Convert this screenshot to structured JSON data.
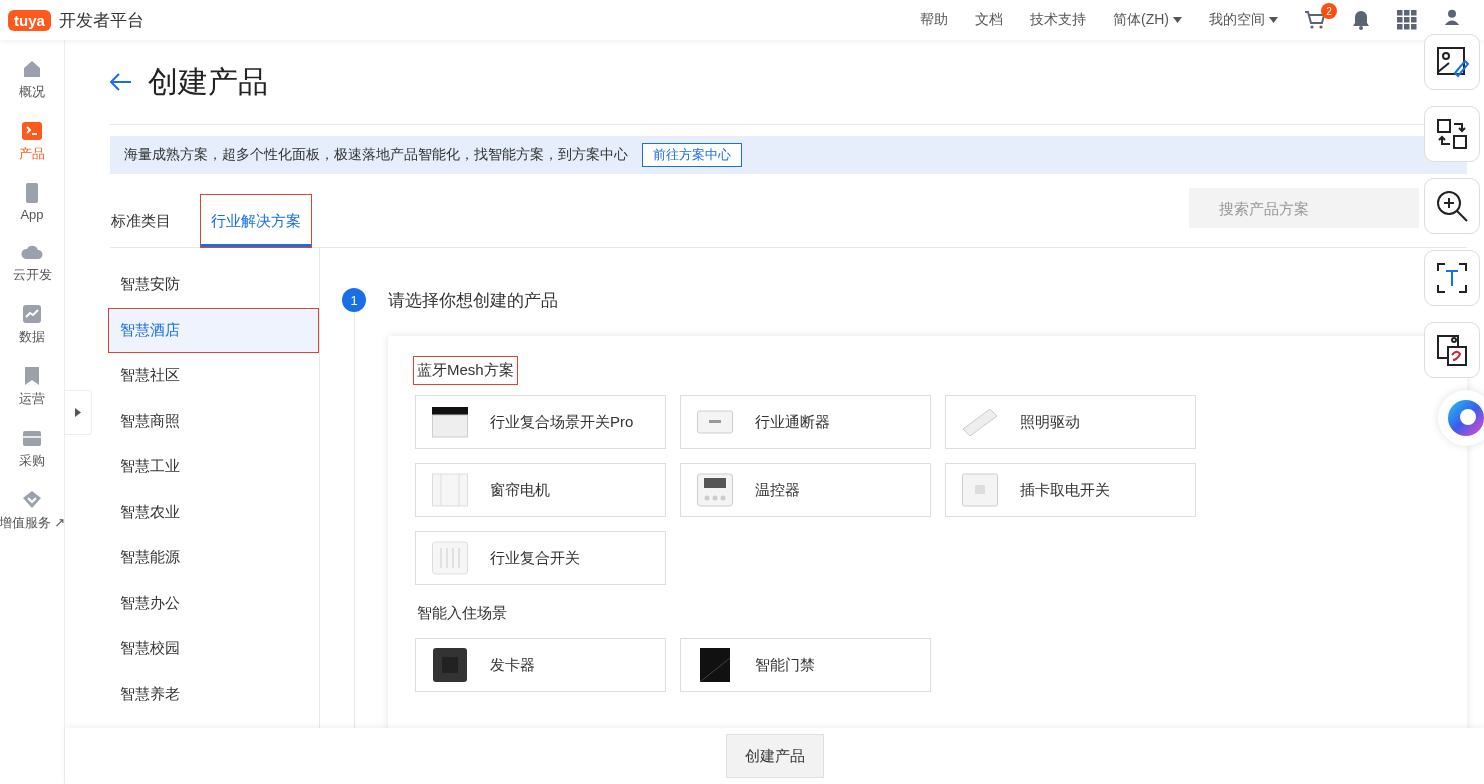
{
  "header": {
    "logo": "tuya",
    "title": "开发者平台",
    "links": [
      {
        "label": "帮助",
        "dropdown": false
      },
      {
        "label": "文档",
        "dropdown": false
      },
      {
        "label": "技术支持",
        "dropdown": false
      },
      {
        "label": "简体(ZH)",
        "dropdown": true
      },
      {
        "label": "我的空间",
        "dropdown": true
      }
    ],
    "cart_badge": "2"
  },
  "rail": [
    {
      "label": "概况",
      "selected": false
    },
    {
      "label": "产品",
      "selected": true
    },
    {
      "label": "App",
      "selected": false
    },
    {
      "label": "云开发",
      "selected": false
    },
    {
      "label": "数据",
      "selected": false
    },
    {
      "label": "运营",
      "selected": false
    },
    {
      "label": "采购",
      "selected": false
    },
    {
      "label": "增值服务",
      "selected": false,
      "external_mark": "↗"
    }
  ],
  "page_title": "创建产品",
  "banner": {
    "text": "海量成熟方案，超多个性化面板，极速落地产品智能化，找智能方案，到方案中心",
    "button": "前往方案中心"
  },
  "tabs": [
    {
      "label": "标准类目",
      "selected": false,
      "annotated": false
    },
    {
      "label": "行业解决方案",
      "selected": true,
      "annotated": true
    }
  ],
  "search": {
    "placeholder": "搜索产品方案"
  },
  "categories": [
    {
      "label": "智慧安防",
      "selected": false,
      "annotated": false
    },
    {
      "label": "智慧酒店",
      "selected": true,
      "annotated": true
    },
    {
      "label": "智慧社区",
      "selected": false,
      "annotated": false
    },
    {
      "label": "智慧商照",
      "selected": false,
      "annotated": false
    },
    {
      "label": "智慧工业",
      "selected": false,
      "annotated": false
    },
    {
      "label": "智慧农业",
      "selected": false,
      "annotated": false
    },
    {
      "label": "智慧能源",
      "selected": false,
      "annotated": false
    },
    {
      "label": "智慧办公",
      "selected": false,
      "annotated": false
    },
    {
      "label": "智慧校园",
      "selected": false,
      "annotated": false
    },
    {
      "label": "智慧养老",
      "selected": false,
      "annotated": false
    }
  ],
  "step": {
    "number": "1",
    "title": "请选择你想创建的产品"
  },
  "groups": [
    {
      "title": "蓝牙Mesh方案",
      "annotated": true,
      "products": [
        {
          "name": "行业复合场景开关Pro",
          "kind": "panel"
        },
        {
          "name": "行业通断器",
          "kind": "breaker"
        },
        {
          "name": "照明驱动",
          "kind": "driver"
        },
        {
          "name": "窗帘电机",
          "kind": "curtain"
        },
        {
          "name": "温控器",
          "kind": "thermostat"
        },
        {
          "name": "插卡取电开关",
          "kind": "cardswitch"
        },
        {
          "name": "行业复合开关",
          "kind": "switch"
        }
      ]
    },
    {
      "title": "智能入住场景",
      "annotated": false,
      "products": [
        {
          "name": "发卡器",
          "kind": "cardreader"
        },
        {
          "name": "智能门禁",
          "kind": "doorlock"
        }
      ]
    }
  ],
  "footer_button": "创建产品"
}
